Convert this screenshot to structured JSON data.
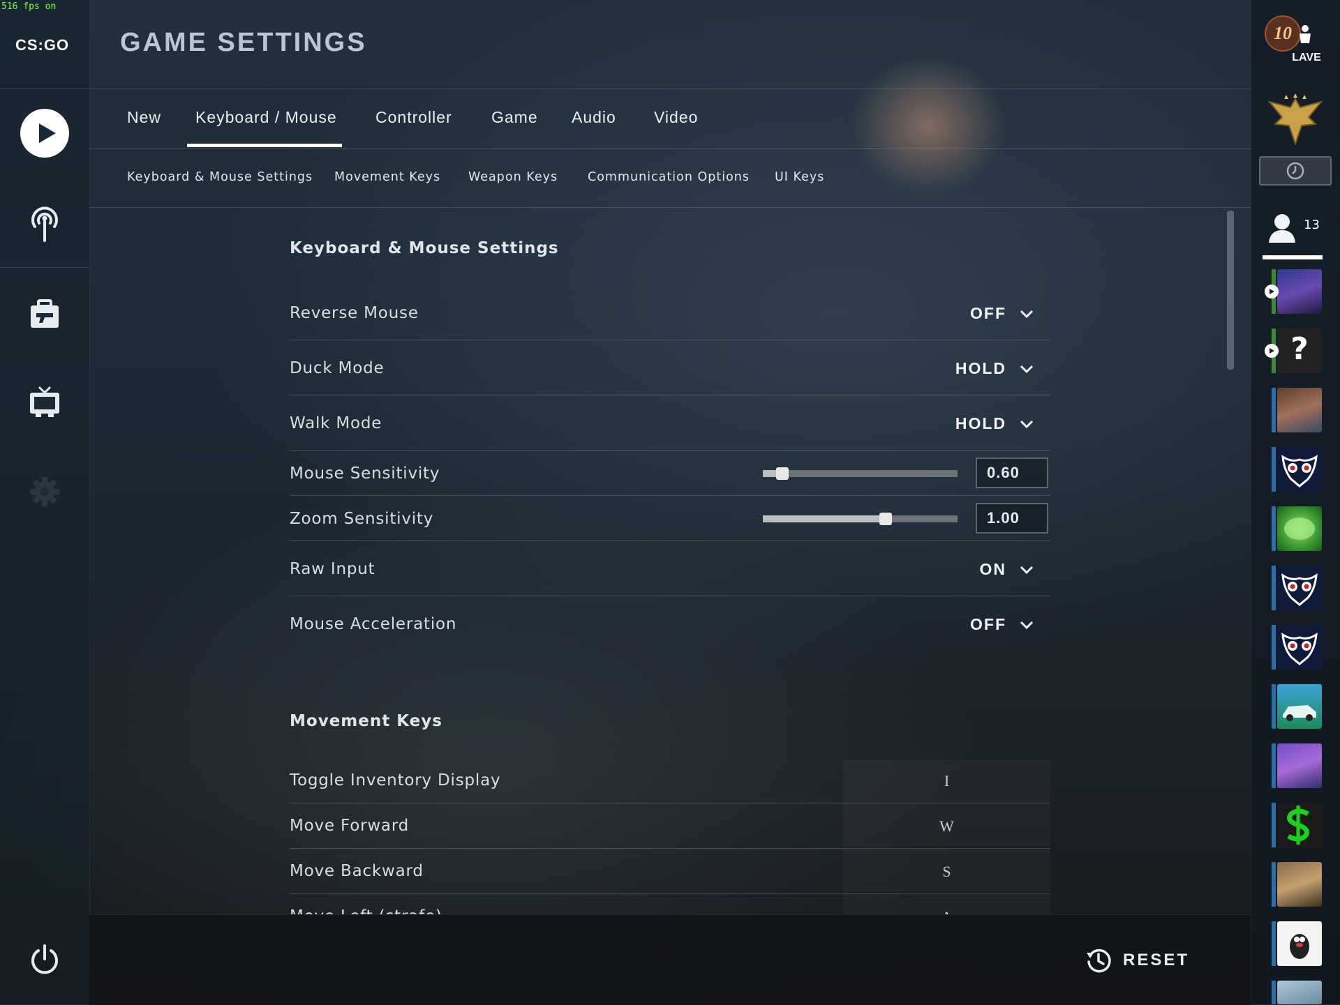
{
  "overlay": {
    "fps_text": "516 fps on"
  },
  "brand": {
    "logo_text": "CS:GO"
  },
  "page": {
    "title": "GAME SETTINGS"
  },
  "tabs": [
    {
      "label": "New"
    },
    {
      "label": "Keyboard / Mouse",
      "active": true
    },
    {
      "label": "Controller"
    },
    {
      "label": "Game"
    },
    {
      "label": "Audio"
    },
    {
      "label": "Video"
    }
  ],
  "subtabs": [
    {
      "label": "Keyboard & Mouse Settings"
    },
    {
      "label": "Movement Keys"
    },
    {
      "label": "Weapon Keys"
    },
    {
      "label": "Communication Options"
    },
    {
      "label": "UI Keys"
    }
  ],
  "sidebar_icons": [
    "play-icon",
    "broadcast-icon",
    "inventory-icon",
    "tv-icon",
    "gear-icon",
    "power-icon"
  ],
  "kb_section": {
    "title": "Keyboard & Mouse Settings",
    "rows": [
      {
        "label": "Reverse Mouse",
        "value": "OFF"
      },
      {
        "label": "Duck Mode",
        "value": "HOLD"
      },
      {
        "label": "Walk Mode",
        "value": "HOLD"
      },
      {
        "label": "Mouse Sensitivity",
        "value": "0.60",
        "slider_fraction": 0.1
      },
      {
        "label": "Zoom Sensitivity",
        "value": "1.00",
        "slider_fraction": 0.63
      },
      {
        "label": "Raw Input",
        "value": "ON"
      },
      {
        "label": "Mouse Acceleration",
        "value": "OFF"
      }
    ]
  },
  "movement_section": {
    "title": "Movement Keys",
    "rows": [
      {
        "label": "Toggle Inventory Display",
        "key": "I"
      },
      {
        "label": "Move Forward",
        "key": "W"
      },
      {
        "label": "Move Backward",
        "key": "S"
      },
      {
        "label": "Move Left (strafe)",
        "key": "A"
      }
    ]
  },
  "footer": {
    "reset_label": "RESET"
  },
  "rightbar": {
    "rank_badge": "10",
    "rank_label": "LAVE",
    "friends_count": "13",
    "friends": [
      {
        "kind": "cat",
        "playing": true,
        "color": "#3a8a3a"
      },
      {
        "kind": "question",
        "playing": true,
        "color": "#3a8a3a",
        "text": "?"
      },
      {
        "kind": "photo-brown",
        "color": "#2b6ea8"
      },
      {
        "kind": "owl",
        "color": "#2b6ea8"
      },
      {
        "kind": "green-blob",
        "color": "#2b6ea8"
      },
      {
        "kind": "owl",
        "color": "#2b6ea8"
      },
      {
        "kind": "owl",
        "color": "#2b6ea8"
      },
      {
        "kind": "car",
        "color": "#2b6ea8"
      },
      {
        "kind": "anime",
        "color": "#2b6ea8"
      },
      {
        "kind": "dollar",
        "color": "#2b6ea8"
      },
      {
        "kind": "photo-man",
        "color": "#2b6ea8"
      },
      {
        "kind": "mole",
        "color": "#2b6ea8"
      },
      {
        "kind": "bird",
        "color": "#2b6ea8"
      }
    ]
  }
}
